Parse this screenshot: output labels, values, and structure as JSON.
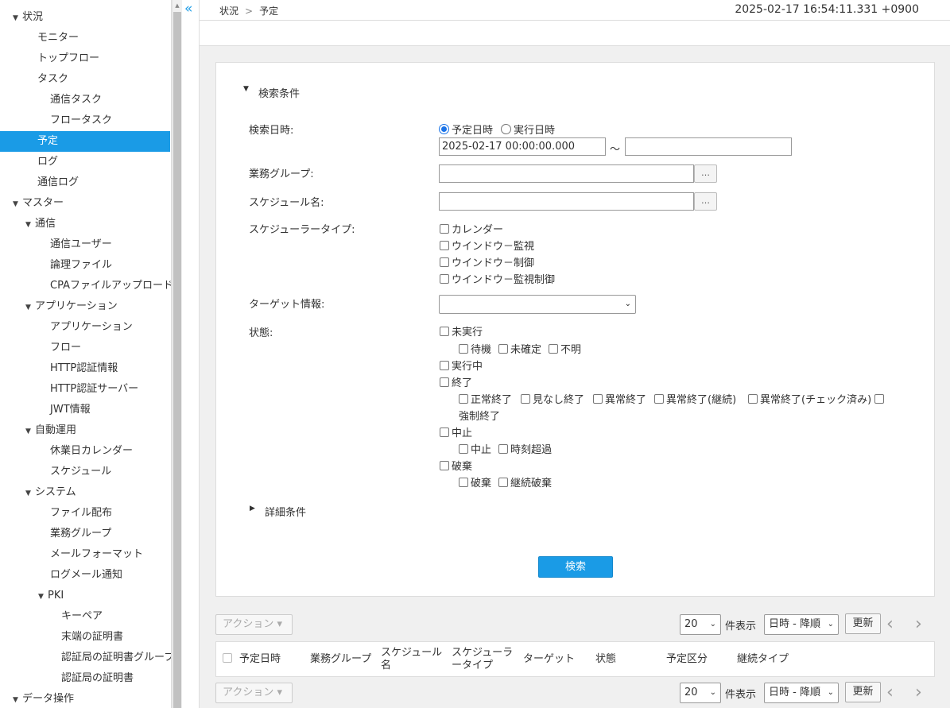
{
  "sidebar": {
    "items": [
      {
        "label": "状況",
        "tri": "▼"
      },
      {
        "label": "モニター"
      },
      {
        "label": "トップフロー"
      },
      {
        "label": "タスク"
      },
      {
        "label": "通信タスク"
      },
      {
        "label": "フロータスク"
      },
      {
        "label": "予定",
        "active": true
      },
      {
        "label": "ログ"
      },
      {
        "label": "通信ログ"
      },
      {
        "label": "マスター",
        "tri": "▼"
      },
      {
        "label": "通信",
        "tri": "▼"
      },
      {
        "label": "通信ユーザー"
      },
      {
        "label": "論理ファイル"
      },
      {
        "label": "CPAファイルアップロード"
      },
      {
        "label": "アプリケーション",
        "tri": "▼"
      },
      {
        "label": "アプリケーション"
      },
      {
        "label": "フロー"
      },
      {
        "label": "HTTP認証情報"
      },
      {
        "label": "HTTP認証サーバー"
      },
      {
        "label": "JWT情報"
      },
      {
        "label": "自動運用",
        "tri": "▼"
      },
      {
        "label": "休業日カレンダー"
      },
      {
        "label": "スケジュール"
      },
      {
        "label": "システム",
        "tri": "▼"
      },
      {
        "label": "ファイル配布"
      },
      {
        "label": "業務グループ"
      },
      {
        "label": "メールフォーマット"
      },
      {
        "label": "ログメール通知"
      },
      {
        "label": "PKI",
        "tri": "▼"
      },
      {
        "label": "キーペア"
      },
      {
        "label": "末端の証明書"
      },
      {
        "label": "認証局の証明書グループ"
      },
      {
        "label": "認証局の証明書"
      },
      {
        "label": "データ操作",
        "tri": "▼"
      }
    ]
  },
  "header": {
    "collapse_icon": "«",
    "breadcrumb": [
      "状況",
      "予定"
    ],
    "breadcrumb_sep": ">",
    "clock": "2025-02-17 16:54:11.331 +0900"
  },
  "search": {
    "section_title": "検索条件",
    "section_tri": "▼",
    "labels": {
      "datetime": "検索日時:",
      "group": "業務グループ:",
      "schedule": "スケジュール名:",
      "scheduler_type": "スケジューラータイプ:",
      "target": "ターゲット情報:",
      "state": "状態:"
    },
    "datetime_options": [
      "予定日時",
      "実行日時"
    ],
    "date_from": "2025-02-17 00:00:00.000",
    "date_to": "",
    "range_sep": "～",
    "dots": "…",
    "group_value": "",
    "schedule_value": "",
    "scheduler_types": [
      "カレンダー",
      "ウインドウ－監視",
      "ウインドウ－制御",
      "ウインドウ－監視制御"
    ],
    "target_value": "",
    "states": {
      "unexecuted": "未実行",
      "unexecuted_sub": [
        "待機",
        "未確定",
        "不明"
      ],
      "running": "実行中",
      "finished": "終了",
      "finished_sub": [
        "正常終了",
        "見なし終了",
        "異常終了",
        "異常終了(継続)",
        "異常終了(チェック済み)"
      ],
      "finished_wrap": "強制終了",
      "stopped": "中止",
      "stopped_sub": [
        "中止",
        "時刻超過"
      ],
      "discarded": "破棄",
      "discarded_sub": [
        "破棄",
        "継続破棄"
      ]
    },
    "detail_title": "詳細条件",
    "detail_tri": "▶",
    "search_button": "検索"
  },
  "toolbar": {
    "action": "アクション ▾",
    "page_size": "20",
    "ken": "件表示",
    "sort": "日時 - 降順",
    "refresh": "更新",
    "prev": "‹",
    "next": "›"
  },
  "table": {
    "columns": [
      "予定日時",
      "業務グループ",
      "スケジュール\n名",
      "スケジューラ\nータイプ",
      "ターゲット",
      "状態",
      "予定区分",
      "継続タイプ"
    ]
  }
}
